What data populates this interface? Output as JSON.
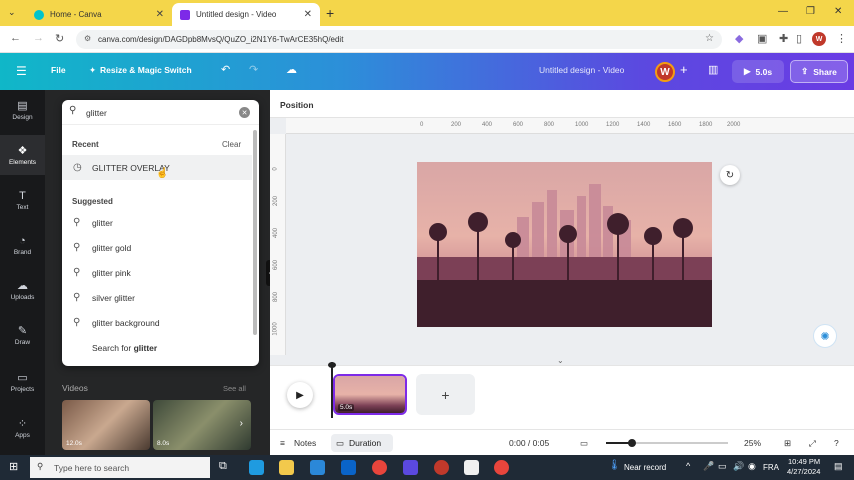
{
  "browser": {
    "tabs": [
      {
        "title": "Home - Canva"
      },
      {
        "title": "Untitled design - Video"
      }
    ],
    "url": "canva.com/design/DAGDpb8MvsQ/QuZO_i2N1Y6-TwArCE35hQ/edit"
  },
  "header": {
    "file_label": "File",
    "resize_label": "Resize & Magic Switch",
    "doc_title": "Untitled design - Video",
    "avatar_letter": "W",
    "duration_label": "5.0s",
    "share_label": "Share"
  },
  "rail": [
    {
      "label": "Design",
      "icon": "layout-icon"
    },
    {
      "label": "Elements",
      "icon": "shapes-icon"
    },
    {
      "label": "Text",
      "icon": "text-icon"
    },
    {
      "label": "Brand",
      "icon": "brand-icon"
    },
    {
      "label": "Uploads",
      "icon": "cloud-upload-icon"
    },
    {
      "label": "Draw",
      "icon": "pen-icon"
    },
    {
      "label": "Projects",
      "icon": "folder-icon"
    },
    {
      "label": "Apps",
      "icon": "apps-grid-icon"
    }
  ],
  "search": {
    "value": "glitter",
    "recent_heading": "Recent",
    "clear_label": "Clear",
    "recent_items": [
      "GLITTER OVERLAY"
    ],
    "suggested_heading": "Suggested",
    "suggestions": [
      "glitter",
      "glitter gold",
      "glitter pink",
      "silver glitter",
      "glitter background"
    ],
    "search_for_prefix": "Search for",
    "search_for_term": "glitter"
  },
  "panel": {
    "videos_heading": "Videos",
    "see_all": "See all",
    "video_thumbs": [
      {
        "duration": "12.0s"
      },
      {
        "duration": "8.0s"
      }
    ]
  },
  "canvas": {
    "position_label": "Position",
    "ruler_ticks": [
      "0",
      "200",
      "400",
      "600",
      "800",
      "1000",
      "1200",
      "1400",
      "1600",
      "1800",
      "2000"
    ],
    "ruler_left_ticks": [
      "0",
      "200",
      "400",
      "600",
      "800",
      "1000"
    ]
  },
  "timeline": {
    "clip_duration": "5.0s"
  },
  "bottom": {
    "notes_label": "Notes",
    "duration_label": "Duration",
    "time_readout": "0:00 / 0:05",
    "zoom": "25%"
  },
  "taskbar": {
    "search_placeholder": "Type here to search",
    "weather": "Near record",
    "lang": "FRA",
    "time": "10:49 PM",
    "date": "4/27/2024"
  },
  "colors": {
    "chrome_tabstrip": "#f4d64a",
    "canva_purple": "#7d2ae8",
    "header_gradient_start": "#10b7c8",
    "header_gradient_end": "#6a3ce4"
  }
}
